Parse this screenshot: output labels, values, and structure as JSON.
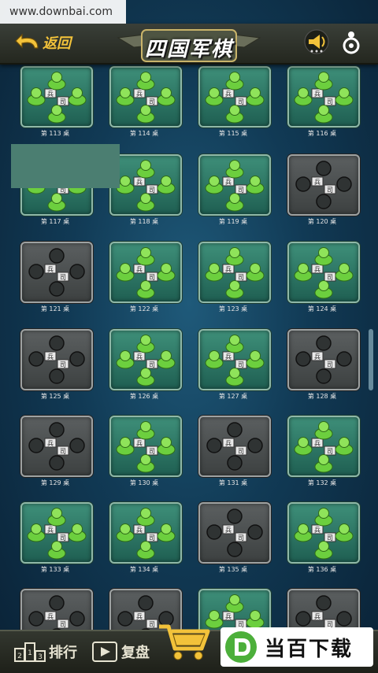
{
  "watermark_top": "www.downbai.com",
  "header": {
    "back_label": "返回",
    "title": "四国军棋"
  },
  "tables": [
    {
      "label": "第 113 桌",
      "state": "active"
    },
    {
      "label": "第 114 桌",
      "state": "active"
    },
    {
      "label": "第 115 桌",
      "state": "active"
    },
    {
      "label": "第 116 桌",
      "state": "active"
    },
    {
      "label": "第 117 桌",
      "state": "active"
    },
    {
      "label": "第 118 桌",
      "state": "active"
    },
    {
      "label": "第 119 桌",
      "state": "active"
    },
    {
      "label": "第 120 桌",
      "state": "empty"
    },
    {
      "label": "第 121 桌",
      "state": "empty"
    },
    {
      "label": "第 122 桌",
      "state": "active"
    },
    {
      "label": "第 123 桌",
      "state": "active"
    },
    {
      "label": "第 124 桌",
      "state": "active"
    },
    {
      "label": "第 125 桌",
      "state": "empty"
    },
    {
      "label": "第 126 桌",
      "state": "active"
    },
    {
      "label": "第 127 桌",
      "state": "active"
    },
    {
      "label": "第 128 桌",
      "state": "empty"
    },
    {
      "label": "第 129 桌",
      "state": "empty"
    },
    {
      "label": "第 130 桌",
      "state": "active"
    },
    {
      "label": "第 131 桌",
      "state": "empty"
    },
    {
      "label": "第 132 桌",
      "state": "active"
    },
    {
      "label": "第 133 桌",
      "state": "active"
    },
    {
      "label": "第 134 桌",
      "state": "active"
    },
    {
      "label": "第 135 桌",
      "state": "empty"
    },
    {
      "label": "第 136 桌",
      "state": "active"
    },
    {
      "label": "",
      "state": "empty"
    },
    {
      "label": "",
      "state": "empty"
    },
    {
      "label": "",
      "state": "active"
    },
    {
      "label": "",
      "state": "empty"
    }
  ],
  "piece_labels": {
    "soldier": "兵",
    "commander": "司"
  },
  "bottom": {
    "rank_label": "排行",
    "replay_label": "复盘"
  },
  "watermark_bottom": "当百下载",
  "colors": {
    "accent": "#f2c23a",
    "active_table": "#2f7a67",
    "empty_table": "#4a4e4f"
  }
}
